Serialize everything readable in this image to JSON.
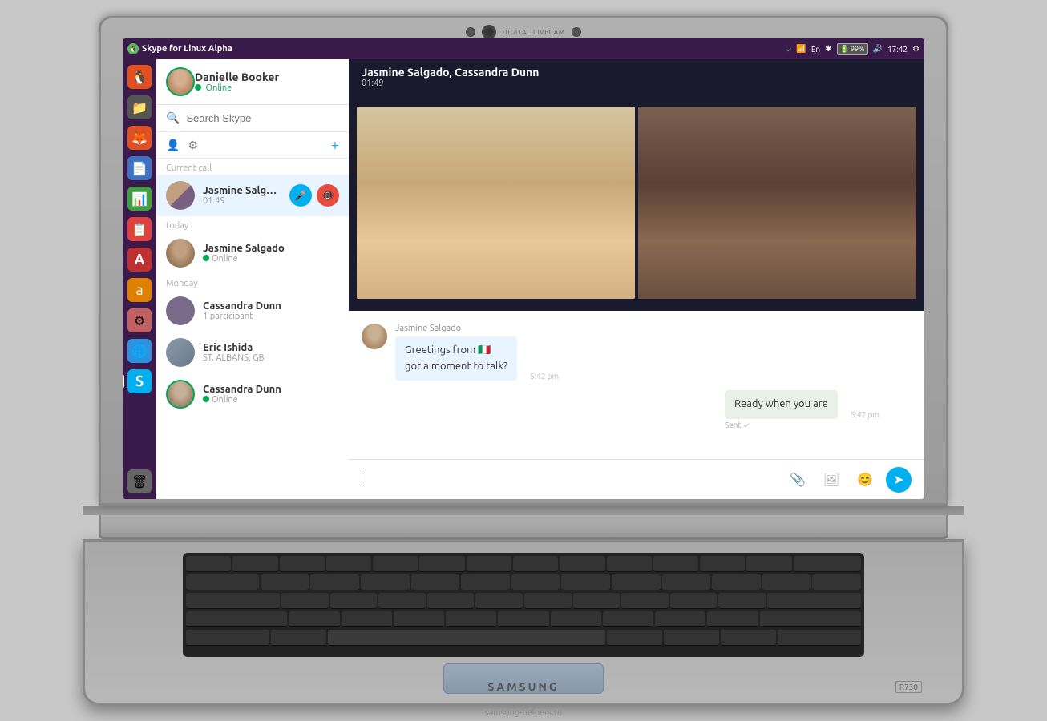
{
  "laptop": {
    "brand": "SAMSUNG",
    "model": "R730",
    "camera_label": "DIGITAL LIVECAM"
  },
  "taskbar": {
    "title": "Skype for Linux Alpha",
    "time": "17:42",
    "battery": "99%",
    "lang": "En"
  },
  "skype": {
    "user": {
      "name": "Danielle Booker",
      "status": "Online"
    },
    "search_placeholder": "Search Skype",
    "toolbar": {
      "add_label": "+"
    },
    "sections": {
      "current_call": "Current call",
      "today": "today",
      "monday": "Monday"
    },
    "conversations": [
      {
        "name": "Jasmine Salgado, Ca...",
        "sub": "01:49",
        "type": "active_call",
        "avatar_type": "group"
      },
      {
        "name": "Jasmine Salgado",
        "sub": "Online",
        "type": "today"
      },
      {
        "name": "Cassandra Dunn",
        "sub": "1 participant",
        "type": "monday"
      },
      {
        "name": "Eric Ishida",
        "sub": "ST. ALBANS, GB",
        "type": "monday"
      },
      {
        "name": "Cassandra Dunn",
        "sub": "Online",
        "type": "monday",
        "online": true
      }
    ]
  },
  "call": {
    "title": "Jasmine Salgado, Cassandra Dunn",
    "timer": "01:49"
  },
  "messages": [
    {
      "sender": "Jasmine Salgado",
      "text1": "Greetings from 🇮🇹",
      "text2": "got a moment to talk?",
      "time": "5:42 pm",
      "type": "received"
    },
    {
      "text": "Ready when you are",
      "time": "5:42 pm",
      "type": "sent",
      "sent_label": "Sent"
    }
  ],
  "chat_input": {
    "placeholder": ""
  },
  "dock_items": [
    {
      "icon": "🐧",
      "name": "ubuntu-icon",
      "color": "#e05020"
    },
    {
      "icon": "📁",
      "name": "files-icon",
      "color": "#e0a020"
    },
    {
      "icon": "🦊",
      "name": "firefox-icon",
      "color": "#e05020"
    },
    {
      "icon": "📄",
      "name": "text-editor-icon",
      "color": "#4070c0"
    },
    {
      "icon": "📊",
      "name": "spreadsheet-icon",
      "color": "#40a040"
    },
    {
      "icon": "📋",
      "name": "docs-icon",
      "color": "#e04040"
    },
    {
      "icon": "A",
      "name": "app-a-icon",
      "color": "#c03030"
    },
    {
      "icon": "a",
      "name": "amazon-icon",
      "color": "#e08000"
    },
    {
      "icon": "⚙",
      "name": "settings-icon",
      "color": "#c06060"
    },
    {
      "icon": "🌐",
      "name": "chrome-icon",
      "color": "#3090e0"
    },
    {
      "icon": "S",
      "name": "skype-dock-icon",
      "color": "#00aff0"
    },
    {
      "icon": "🗑",
      "name": "trash-icon",
      "color": "#888888"
    }
  ],
  "footer": {
    "website": "samsung-helpers.ru"
  }
}
